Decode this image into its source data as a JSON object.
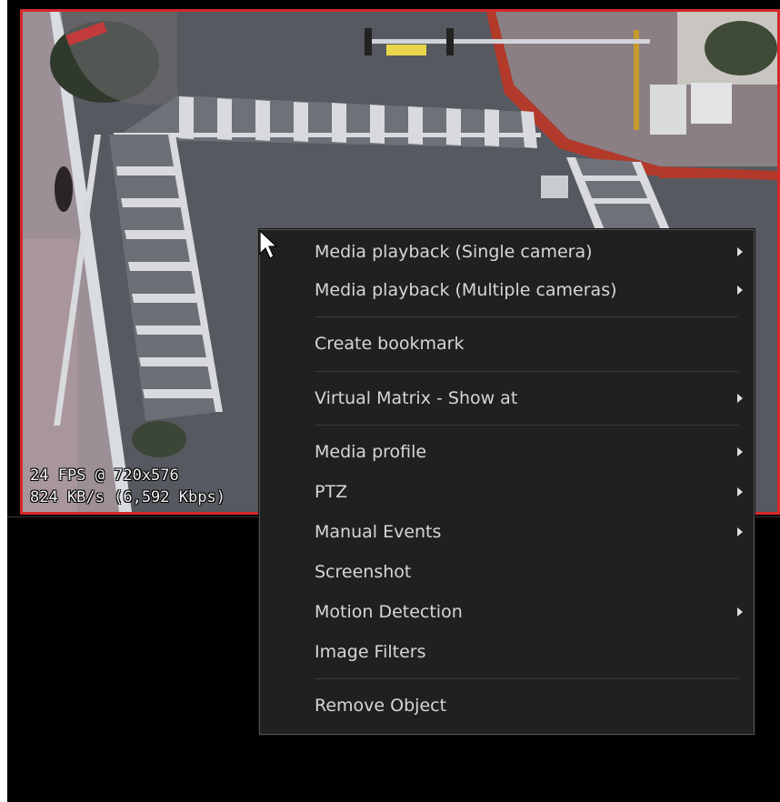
{
  "video": {
    "fps_line": "24 FPS @ 720x576",
    "rate_line": "824 KB/s (6,592 Kbps)",
    "border_color": "#d42a2a"
  },
  "context_menu": {
    "items": [
      {
        "label": "Media playback (Single camera)",
        "submenu": true
      },
      {
        "label": "Media playback (Multiple cameras)",
        "submenu": true
      },
      {
        "label": "Create bookmark",
        "submenu": false
      },
      {
        "label": "Virtual Matrix - Show at",
        "submenu": true
      },
      {
        "label": "Media profile",
        "submenu": true
      },
      {
        "label": "PTZ",
        "submenu": true
      },
      {
        "label": "Manual Events",
        "submenu": true
      },
      {
        "label": "Screenshot",
        "submenu": false
      },
      {
        "label": "Motion Detection",
        "submenu": true
      },
      {
        "label": "Image Filters",
        "submenu": false
      },
      {
        "label": "Remove Object",
        "submenu": false
      }
    ]
  },
  "icons": {
    "cursor": "mouse-pointer-icon",
    "submenu_arrow": "chevron-right-icon"
  }
}
